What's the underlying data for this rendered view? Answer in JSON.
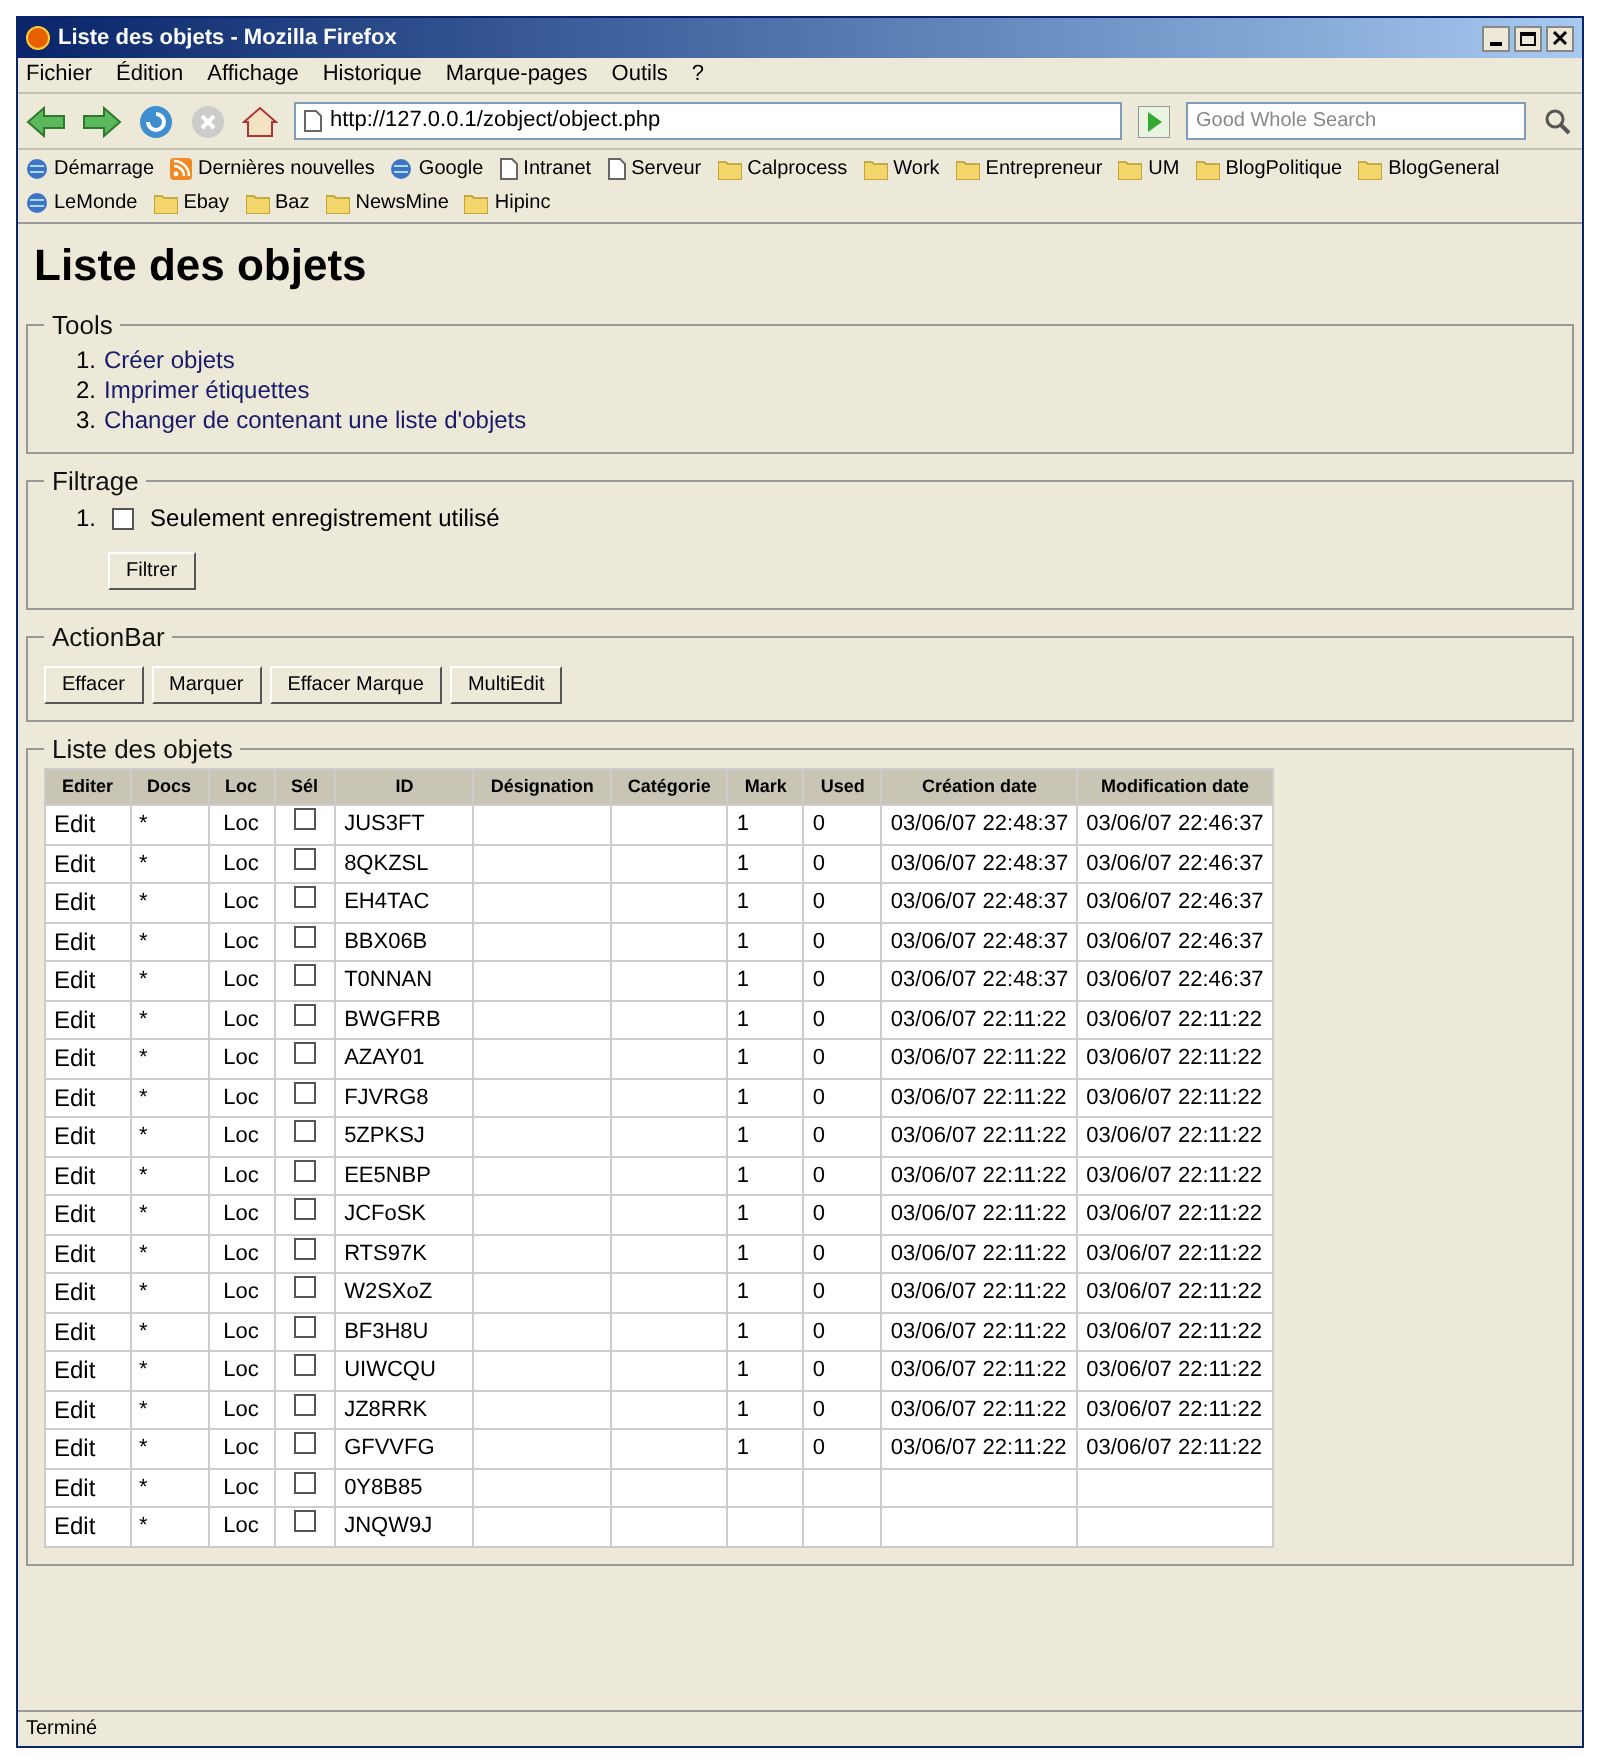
{
  "window": {
    "title": "Liste des objets - Mozilla Firefox"
  },
  "menu": [
    "Fichier",
    "Édition",
    "Affichage",
    "Historique",
    "Marque-pages",
    "Outils",
    "?"
  ],
  "address": {
    "value": "http://127.0.0.1/zobject/object.php"
  },
  "search": {
    "placeholder": "Good Whole Search"
  },
  "bookmarks": [
    {
      "label": "Démarrage",
      "kind": "site"
    },
    {
      "label": "Dernières nouvelles",
      "kind": "feed"
    },
    {
      "label": "Google",
      "kind": "site"
    },
    {
      "label": "Intranet",
      "kind": "page"
    },
    {
      "label": "Serveur",
      "kind": "page"
    },
    {
      "label": "Calprocess",
      "kind": "folder"
    },
    {
      "label": "Work",
      "kind": "folder"
    },
    {
      "label": "Entrepreneur",
      "kind": "folder"
    },
    {
      "label": "UM",
      "kind": "folder"
    },
    {
      "label": "BlogPolitique",
      "kind": "folder"
    },
    {
      "label": "BlogGeneral",
      "kind": "folder"
    },
    {
      "label": "LeMonde",
      "kind": "site"
    },
    {
      "label": "Ebay",
      "kind": "folder"
    },
    {
      "label": "Baz",
      "kind": "folder"
    },
    {
      "label": "NewsMine",
      "kind": "folder"
    },
    {
      "label": "Hipinc",
      "kind": "folder"
    }
  ],
  "page": {
    "title": "Liste des objets",
    "tools": {
      "legend": "Tools",
      "items": [
        {
          "number": "1.",
          "label": "Créer objets"
        },
        {
          "number": "2.",
          "label": "Imprimer étiquettes"
        },
        {
          "number": "3.",
          "label": "Changer de contenant une liste d'objets"
        }
      ]
    },
    "filter": {
      "legend": "Filtrage",
      "options": [
        {
          "number": "1.",
          "label": "Seulement enregistrement utilisé",
          "checked": false
        }
      ],
      "button": "Filtrer"
    },
    "action_bar": {
      "legend": "ActionBar",
      "buttons": [
        "Effacer",
        "Marquer",
        "Effacer Marque",
        "MultiEdit"
      ]
    },
    "list": {
      "legend": "Liste des objets",
      "columns": [
        "Editer",
        "Docs",
        "Loc",
        "Sél",
        "ID",
        "Désignation",
        "Catégorie",
        "Mark",
        "Used",
        "Création date",
        "Modification date"
      ],
      "rows": [
        {
          "edit": "Edit",
          "docs": "*",
          "loc": "Loc",
          "sel": false,
          "id": "JUS3FT",
          "mark": "1",
          "used": "0",
          "created": "03/06/07 22:48:37",
          "modified": "03/06/07 22:46:37"
        },
        {
          "edit": "Edit",
          "docs": "*",
          "loc": "Loc",
          "sel": false,
          "id": "8QKZSL",
          "mark": "1",
          "used": "0",
          "created": "03/06/07 22:48:37",
          "modified": "03/06/07 22:46:37"
        },
        {
          "edit": "Edit",
          "docs": "*",
          "loc": "Loc",
          "sel": false,
          "id": "EH4TAC",
          "mark": "1",
          "used": "0",
          "created": "03/06/07 22:48:37",
          "modified": "03/06/07 22:46:37"
        },
        {
          "edit": "Edit",
          "docs": "*",
          "loc": "Loc",
          "sel": false,
          "id": "BBX06B",
          "mark": "1",
          "used": "0",
          "created": "03/06/07 22:48:37",
          "modified": "03/06/07 22:46:37"
        },
        {
          "edit": "Edit",
          "docs": "*",
          "loc": "Loc",
          "sel": false,
          "id": "T0NNAN",
          "mark": "1",
          "used": "0",
          "created": "03/06/07 22:48:37",
          "modified": "03/06/07 22:46:37"
        },
        {
          "edit": "Edit",
          "docs": "*",
          "loc": "Loc",
          "sel": false,
          "id": "BWGFRB",
          "mark": "1",
          "used": "0",
          "created": "03/06/07 22:11:22",
          "modified": "03/06/07 22:11:22"
        },
        {
          "edit": "Edit",
          "docs": "*",
          "loc": "Loc",
          "sel": false,
          "id": "AZAY01",
          "mark": "1",
          "used": "0",
          "created": "03/06/07 22:11:22",
          "modified": "03/06/07 22:11:22"
        },
        {
          "edit": "Edit",
          "docs": "*",
          "loc": "Loc",
          "sel": false,
          "id": "FJVRG8",
          "mark": "1",
          "used": "0",
          "created": "03/06/07 22:11:22",
          "modified": "03/06/07 22:11:22"
        },
        {
          "edit": "Edit",
          "docs": "*",
          "loc": "Loc",
          "sel": false,
          "id": "5ZPKSJ",
          "mark": "1",
          "used": "0",
          "created": "03/06/07 22:11:22",
          "modified": "03/06/07 22:11:22"
        },
        {
          "edit": "Edit",
          "docs": "*",
          "loc": "Loc",
          "sel": false,
          "id": "EE5NBP",
          "mark": "1",
          "used": "0",
          "created": "03/06/07 22:11:22",
          "modified": "03/06/07 22:11:22"
        },
        {
          "edit": "Edit",
          "docs": "*",
          "loc": "Loc",
          "sel": false,
          "id": "JCFoSK",
          "mark": "1",
          "used": "0",
          "created": "03/06/07 22:11:22",
          "modified": "03/06/07 22:11:22"
        },
        {
          "edit": "Edit",
          "docs": "*",
          "loc": "Loc",
          "sel": false,
          "id": "RTS97K",
          "mark": "1",
          "used": "0",
          "created": "03/06/07 22:11:22",
          "modified": "03/06/07 22:11:22"
        },
        {
          "edit": "Edit",
          "docs": "*",
          "loc": "Loc",
          "sel": false,
          "id": "W2SXoZ",
          "mark": "1",
          "used": "0",
          "created": "03/06/07 22:11:22",
          "modified": "03/06/07 22:11:22"
        },
        {
          "edit": "Edit",
          "docs": "*",
          "loc": "Loc",
          "sel": false,
          "id": "BF3H8U",
          "mark": "1",
          "used": "0",
          "created": "03/06/07 22:11:22",
          "modified": "03/06/07 22:11:22"
        },
        {
          "edit": "Edit",
          "docs": "*",
          "loc": "Loc",
          "sel": false,
          "id": "UIWCQU",
          "mark": "1",
          "used": "0",
          "created": "03/06/07 22:11:22",
          "modified": "03/06/07 22:11:22"
        },
        {
          "edit": "Edit",
          "docs": "*",
          "loc": "Loc",
          "sel": false,
          "id": "JZ8RRK",
          "mark": "1",
          "used": "0",
          "created": "03/06/07 22:11:22",
          "modified": "03/06/07 22:11:22"
        },
        {
          "edit": "Edit",
          "docs": "*",
          "loc": "Loc",
          "sel": false,
          "id": "GFVVFG",
          "mark": "1",
          "used": "0",
          "created": "03/06/07 22:11:22",
          "modified": "03/06/07 22:11:22"
        },
        {
          "edit": "Edit",
          "docs": "*",
          "loc": "Loc",
          "sel": false,
          "id": "0Y8B85"
        },
        {
          "edit": "Edit",
          "docs": "*",
          "loc": "Loc",
          "sel": false,
          "id": "JNQW9J"
        }
      ]
    }
  },
  "status_bar": {
    "text": "Terminé"
  }
}
